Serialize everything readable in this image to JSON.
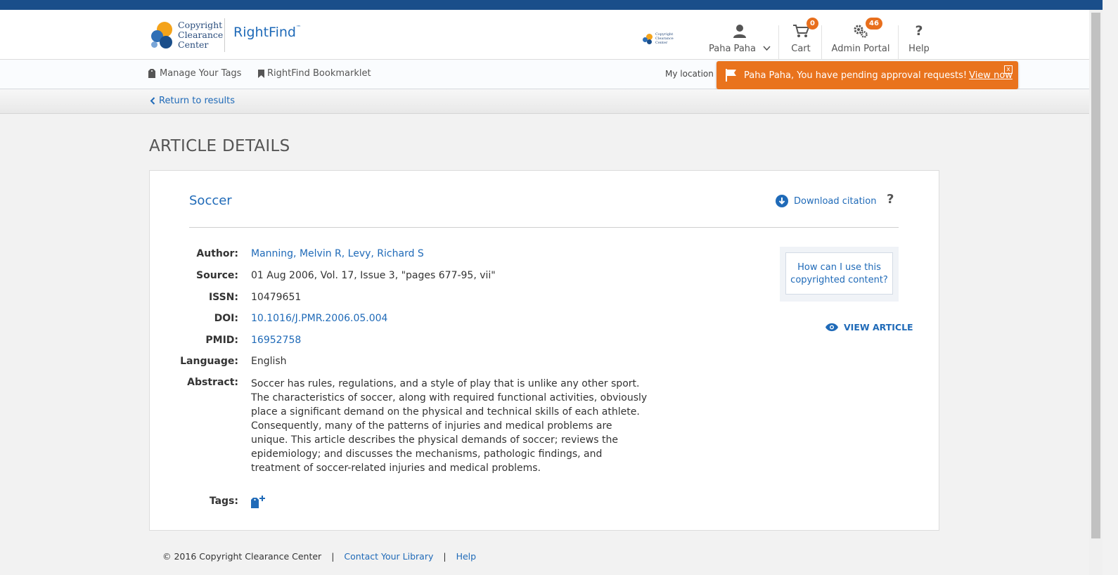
{
  "header": {
    "logo_text": [
      "Copyright",
      "Clearance",
      "Center"
    ],
    "product": "RightFind",
    "product_tm": "™",
    "mini_logo_text": [
      "Copyright",
      "Clearance",
      "Center"
    ],
    "user_label": "Paha Paha",
    "cart_label": "Cart",
    "cart_count": "0",
    "admin_label": "Admin Portal",
    "admin_count": "46",
    "help_label": "Help"
  },
  "subnav": {
    "manage_tags": "Manage Your Tags",
    "bookmarklet": "RightFind Bookmarklet",
    "my_location": "My location &"
  },
  "banner": {
    "message": "Paha Paha, You have pending approval requests!",
    "link": "View now",
    "close": "x"
  },
  "backbar": {
    "return_label": "Return to results"
  },
  "page_title": "ARTICLE DETAILS",
  "article": {
    "title": "Soccer",
    "download_citation": "Download citation",
    "help": "?",
    "fields": {
      "author": {
        "label": "Author:",
        "value": "Manning, Melvin R, Levy, Richard S"
      },
      "source": {
        "label": "Source:",
        "value": "01 Aug 2006, Vol. 17, Issue 3, \"pages 677-95, vii\""
      },
      "issn": {
        "label": "ISSN:",
        "value": "10479651"
      },
      "doi": {
        "label": "DOI:",
        "value": "10.1016/J.PMR.2006.05.004"
      },
      "pmid": {
        "label": "PMID:",
        "value": "16952758"
      },
      "language": {
        "label": "Language:",
        "value": "English"
      },
      "abstract": {
        "label": "Abstract:",
        "value": "Soccer has rules, regulations, and a style of play that is unlike any other sport. The characteristics of soccer, along with required functional activities, obviously place a significant demand on the physical and technical skills of each athlete. Consequently, many of the patterns of injuries and medical problems are unique. This article describes the physical demands of soccer; reviews the epidemiology; and discusses the mechanisms, pathologic findings, and treatment of soccer-related injuries and medical problems."
      },
      "tags": {
        "label": "Tags:"
      }
    },
    "use_content": "How can I use this copyrighted content?",
    "view_article": "VIEW ARTICLE"
  },
  "footer": {
    "copyright": "© 2016 Copyright Clearance Center",
    "sep": "|",
    "contact": "Contact Your Library",
    "help": "Help"
  },
  "colors": {
    "brand_blue": "#1f6ab8",
    "top_bar": "#1a4e8a",
    "alert_orange": "#e9731d",
    "badge_orange": "#e86f1d"
  }
}
